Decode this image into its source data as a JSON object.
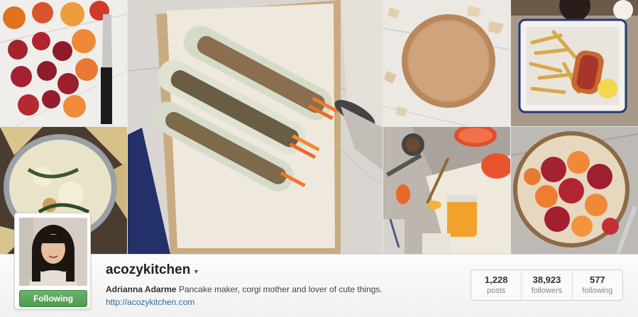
{
  "profile": {
    "username": "acozykitchen",
    "full_name": "Adrianna Adarme",
    "bio": "Pancake maker, corgi mother and lover of cute things.",
    "website": "http://acozykitchen.com",
    "follow_button": "Following"
  },
  "stats": [
    {
      "value": "1,228",
      "label": "posts"
    },
    {
      "value": "38,923",
      "label": "followers"
    },
    {
      "value": "577",
      "label": "following"
    }
  ],
  "photos": [
    "blood-oranges-photo",
    "spinach-dip-photo",
    "spring-rolls-photo",
    "tart-crust-photo",
    "fries-hotdog-photo",
    "grapefruit-curd-photo",
    "orange-tart-photo"
  ],
  "colors": {
    "follow_green": "#4e9a4f",
    "link_blue": "#2a6aa3"
  }
}
